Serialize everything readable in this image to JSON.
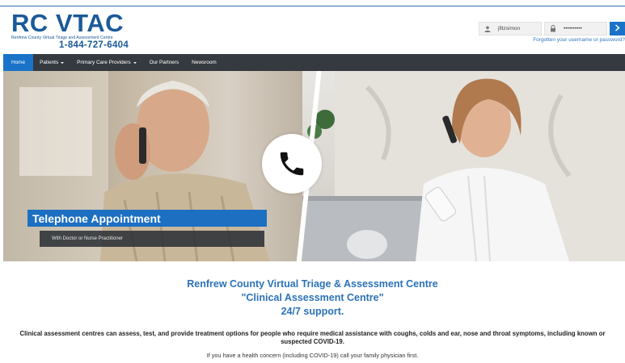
{
  "header": {
    "logo_main": "RC VTAC",
    "logo_sub": "Renfrew County Virtual Triage and Assessment Centre",
    "phone": "1-844-727-6404"
  },
  "login": {
    "username_value": "jfitzsimon",
    "password_value": "••••••••••",
    "submit_icon": "chevron-right-icon",
    "forgot_link": "Forgotten your username or password?"
  },
  "nav": {
    "items": [
      {
        "label": "Home",
        "active": true
      },
      {
        "label": "Patients",
        "dropdown": true
      },
      {
        "label": "Primary Care Providers",
        "dropdown": true
      },
      {
        "label": "Our Partners"
      },
      {
        "label": "Newsroom"
      }
    ]
  },
  "hero": {
    "title": "Telephone Appointment",
    "subtitle": "With Doctor or Nurse Practitioner",
    "icon": "phone-icon",
    "colors": {
      "accent": "#1d6fc2",
      "nav_bg": "#353a40"
    }
  },
  "content": {
    "heading_line1": "Renfrew County Virtual Triage & Assessment Centre",
    "heading_line2": "\"Clinical Assessment Centre\"",
    "heading_line3": "24/7 support.",
    "paragraph1": "Clinical assessment centres can assess, test, and provide treatment options for people who require medical assistance with coughs, colds and ear, nose and throat symptoms, including known or suspected COVID-19.",
    "paragraph2": "If you have a health concern (including COVID-19) call your family physician first."
  }
}
